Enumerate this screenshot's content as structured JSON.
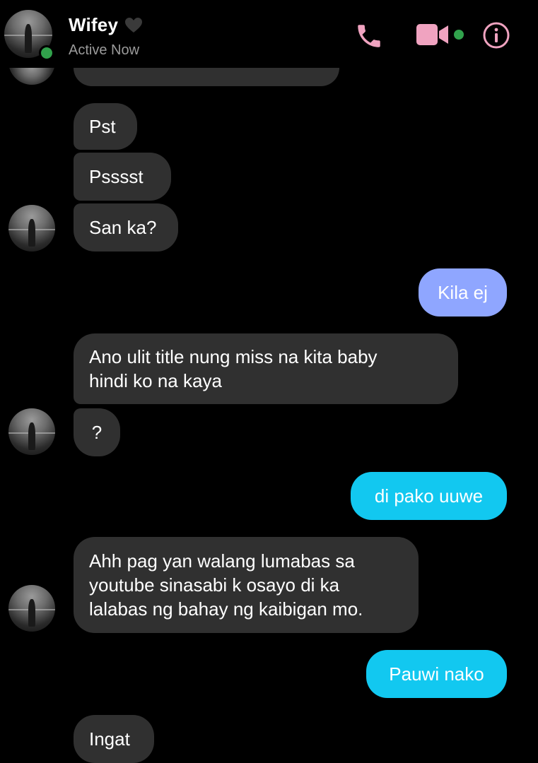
{
  "header": {
    "contact_name": "Wifey",
    "status": "Active Now",
    "icons": [
      "phone-icon",
      "video-call-icon",
      "info-icon"
    ],
    "accent_color": "#f0a3c0",
    "online_color": "#31a24c"
  },
  "messages": [
    {
      "sender": "contact",
      "text": "Pst"
    },
    {
      "sender": "contact",
      "text": "Psssst"
    },
    {
      "sender": "contact",
      "text": "San ka?"
    },
    {
      "sender": "me",
      "text": "Kila ej",
      "color": "#8fa6ff"
    },
    {
      "sender": "contact",
      "text": "Ano ulit title nung miss na kita baby\nhindi ko na kaya"
    },
    {
      "sender": "contact",
      "text": "?"
    },
    {
      "sender": "me",
      "text": "di pako uuwe",
      "color": "#12c8f0"
    },
    {
      "sender": "contact",
      "text": "Ahh pag yan walang lumabas sa\nyoutube sinasabi k osayo di ka\nlalabas ng bahay ng kaibigan mo."
    },
    {
      "sender": "me",
      "text": "Pauwi nako",
      "color": "#12c8f0"
    },
    {
      "sender": "contact",
      "text": "Ingat"
    }
  ]
}
